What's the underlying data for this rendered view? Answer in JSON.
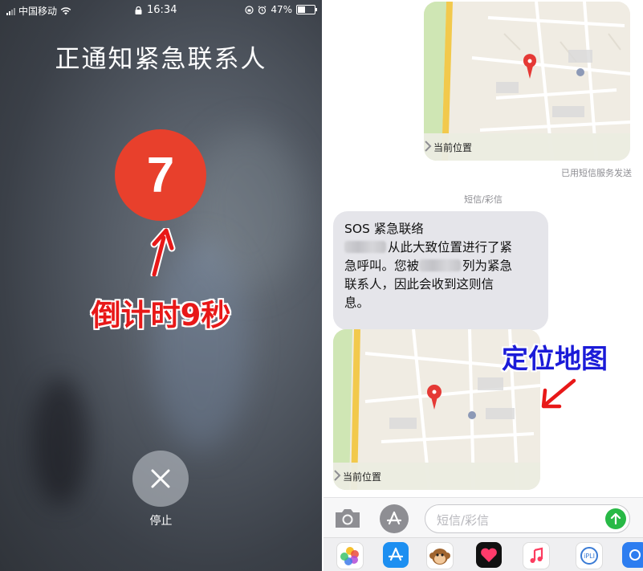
{
  "left_panel": {
    "status_bar": {
      "carrier": "中国移动",
      "time": "16:34",
      "battery": "47%",
      "battery_level": 0.47
    },
    "title": "正通知紧急联系人",
    "countdown_value": "7",
    "annotation": "倒计时9秒",
    "stop_label": "停止",
    "accent_color": "#e8402c",
    "annotation_color": "#e81818"
  },
  "right_panel": {
    "map_top": {
      "label": "当前位置"
    },
    "delivered_status": "已用短信服务发送",
    "section_label": "短信/彩信",
    "message": {
      "line1": "SOS 紧急联络",
      "line2_text": "从此大致位置进行了紧",
      "line3_a": "急呼叫。您被",
      "line3_b": "列为紧急",
      "line4": "联系人，因此会收到这则信",
      "line5": "息。"
    },
    "map_bottom": {
      "label": "当前位置"
    },
    "annotation": "定位地图",
    "annotation_color": "#1b1bd8",
    "input_placeholder": "短信/彩信",
    "send_color": "#28b946",
    "app_drawer": [
      "photos-icon",
      "app-store-icon",
      "animoji-icon",
      "digital-touch-icon",
      "music-icon",
      "app-icon",
      "app-icon-partial"
    ]
  }
}
